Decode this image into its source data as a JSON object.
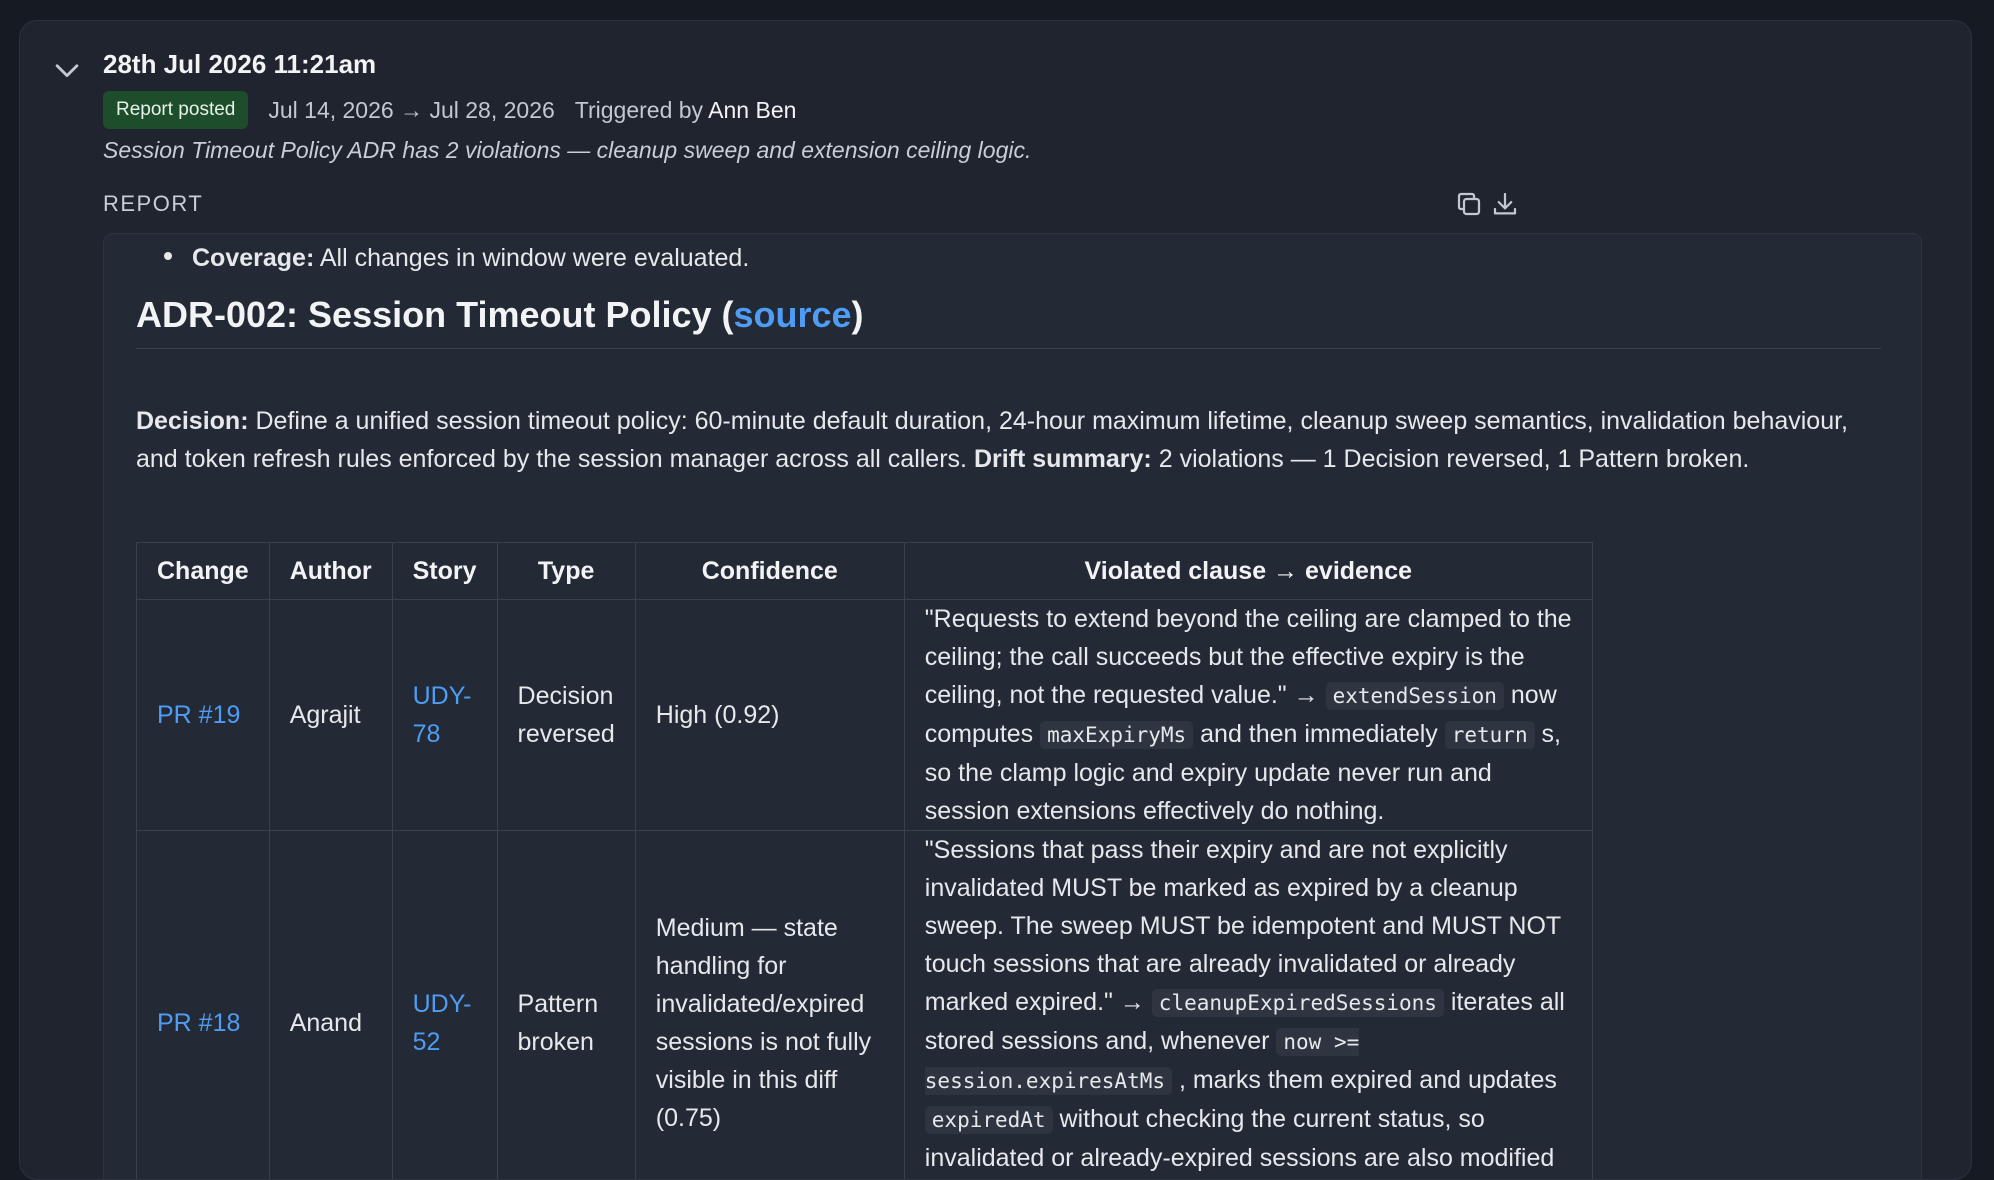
{
  "run": {
    "timestamp": "28th Jul 2026 11:21am",
    "status_badge": "Report posted",
    "date_range": "Jul 14, 2026 → Jul 28, 2026",
    "triggered_prefix": "Triggered by",
    "triggered_by": "Ann Ben",
    "summary": "Session Timeout Policy ADR has 2 violations — cleanup sweep and extension ceiling logic."
  },
  "report": {
    "label": "REPORT",
    "coverage_label": "Coverage:",
    "coverage_text": "All changes in window were evaluated.",
    "adr_title_prefix": "ADR-002: Session Timeout Policy (",
    "adr_source_link": "source",
    "adr_title_suffix": ")",
    "decision_label": "Decision:",
    "decision_text": "Define a unified session timeout policy: 60-minute default duration, 24-hour maximum lifetime, cleanup sweep semantics, invalidation behaviour, and token refresh rules enforced by the session manager across all callers.",
    "drift_label": "Drift summary:",
    "drift_text": "2 violations — 1 Decision reversed, 1 Pattern broken.",
    "table": {
      "headers": [
        "Change",
        "Author",
        "Story",
        "Type",
        "Confidence",
        "Violated clause → evidence"
      ],
      "rows": [
        {
          "change": "PR #19",
          "author": "Agrajit",
          "story": "UDY-78",
          "type": "Decision reversed",
          "confidence": "High (0.92)",
          "evidence": {
            "t1": "\"Requests to extend beyond the ceiling are clamped to the ceiling; the call succeeds but the effective expiry is the ceiling, not the requested value.\" → ",
            "c1": "extendSession",
            "t2": " now computes ",
            "c2": "maxExpiryMs",
            "t3": " and then immediately ",
            "c3": "return",
            "t4": " s, so the clamp logic and expiry update never run and session extensions effectively do nothing."
          }
        },
        {
          "change": "PR #18",
          "author": "Anand",
          "story": "UDY-52",
          "type": "Pattern broken",
          "confidence": "Medium — state handling for invalidated/expired sessions is not fully visible in this diff (0.75)",
          "evidence": {
            "t1": "\"Sessions that pass their expiry and are not explicitly invalidated MUST be marked as expired by a cleanup sweep. The sweep MUST be idempotent and MUST NOT touch sessions that are already invalidated or already marked expired.\" → ",
            "c1": "cleanupExpiredSessions",
            "t2": " iterates all stored sessions and, whenever ",
            "c2": "now >= session.expiresAtMs",
            "t3": " , marks them expired and updates ",
            "c3": "expiredAt",
            "t4": " without checking the current status, so invalidated or already-expired sessions are also modified during the sweep."
          }
        }
      ]
    }
  },
  "icons": {
    "collapse": "chevron-down-icon",
    "copy": "copy-icon",
    "download": "download-icon"
  },
  "colors": {
    "background": "#161a22",
    "card": "#1f242e",
    "panel": "#232a35",
    "link": "#4e9cf4",
    "badge": "#1e4d2c"
  }
}
